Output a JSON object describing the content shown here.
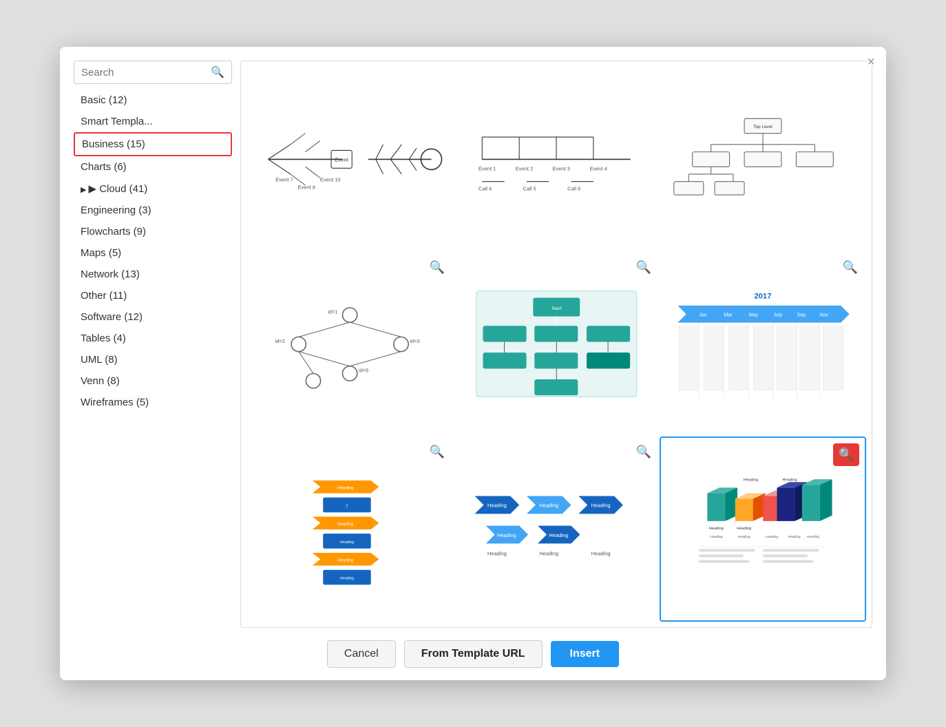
{
  "dialog": {
    "close_label": "×"
  },
  "search": {
    "placeholder": "Search",
    "label": "Search"
  },
  "sidebar": {
    "items": [
      {
        "id": "basic",
        "label": "Basic (12)",
        "active": false,
        "arrow": false
      },
      {
        "id": "smart-templates",
        "label": "Smart Templa...",
        "active": false,
        "arrow": false
      },
      {
        "id": "business",
        "label": "Business (15)",
        "active": true,
        "arrow": false
      },
      {
        "id": "charts",
        "label": "Charts (6)",
        "active": false,
        "arrow": false
      },
      {
        "id": "cloud",
        "label": "Cloud (41)",
        "active": false,
        "arrow": true
      },
      {
        "id": "engineering",
        "label": "Engineering (3)",
        "active": false,
        "arrow": false
      },
      {
        "id": "flowcharts",
        "label": "Flowcharts (9)",
        "active": false,
        "arrow": false
      },
      {
        "id": "maps",
        "label": "Maps (5)",
        "active": false,
        "arrow": false
      },
      {
        "id": "network",
        "label": "Network (13)",
        "active": false,
        "arrow": false
      },
      {
        "id": "other",
        "label": "Other (11)",
        "active": false,
        "arrow": false
      },
      {
        "id": "software",
        "label": "Software (12)",
        "active": false,
        "arrow": false
      },
      {
        "id": "tables",
        "label": "Tables (4)",
        "active": false,
        "arrow": false
      },
      {
        "id": "uml",
        "label": "UML (8)",
        "active": false,
        "arrow": false
      },
      {
        "id": "venn",
        "label": "Venn (8)",
        "active": false,
        "arrow": false
      },
      {
        "id": "wireframes",
        "label": "Wireframes (5)",
        "active": false,
        "arrow": false
      }
    ]
  },
  "footer": {
    "cancel_label": "Cancel",
    "template_url_label": "From Template URL",
    "insert_label": "Insert"
  }
}
